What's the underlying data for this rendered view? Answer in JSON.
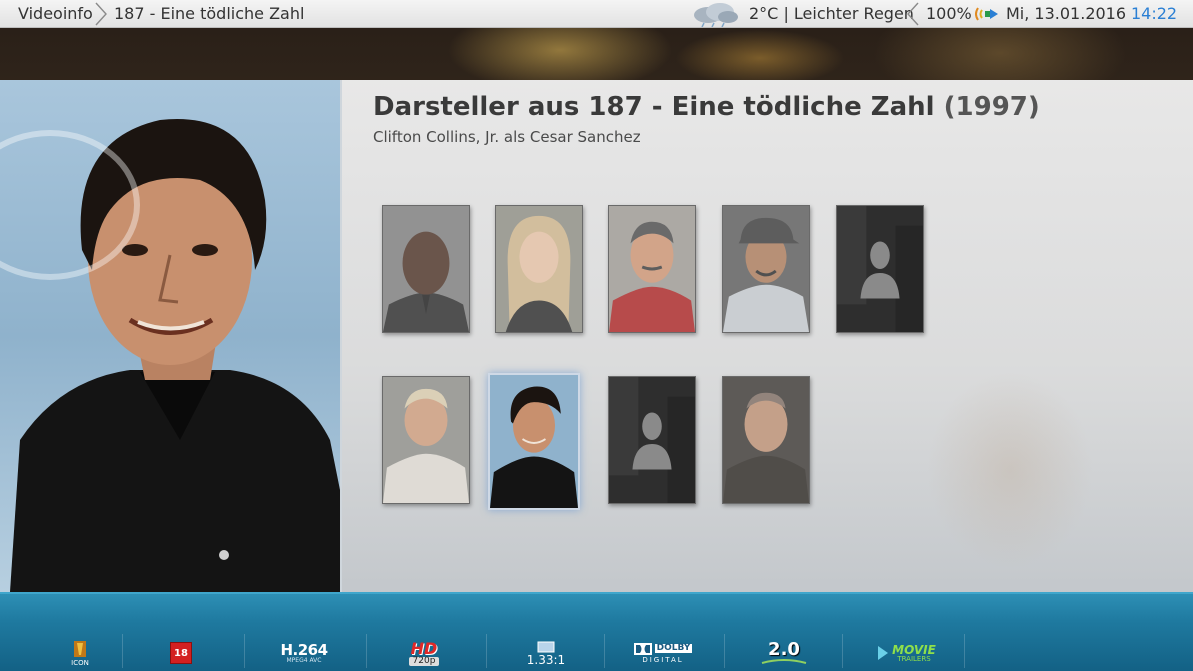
{
  "topbar": {
    "breadcrumb_root": "Videoinfo",
    "breadcrumb_current": "187 - Eine tödliche Zahl",
    "weather": "2°C | Leichter Regen",
    "volume": "100%",
    "date": "Mi, 13.01.2016",
    "time": "14:22"
  },
  "header": {
    "title_prefix": "Darsteller aus 187 - Eine tödliche Zahl",
    "title_year": "(1997)",
    "subtitle": "Clifton Collins, Jr. als Cesar Sanchez"
  },
  "cast": [
    {
      "id": "cast-1",
      "photo": "actor-photo"
    },
    {
      "id": "cast-2",
      "photo": "actor-photo"
    },
    {
      "id": "cast-3",
      "photo": "actor-photo"
    },
    {
      "id": "cast-4",
      "photo": "actor-photo"
    },
    {
      "id": "cast-5",
      "photo": "placeholder-silhouette"
    },
    {
      "id": "cast-6",
      "photo": "actor-photo"
    },
    {
      "id": "cast-7",
      "photo": "actor-photo",
      "selected": true
    },
    {
      "id": "cast-8",
      "photo": "placeholder-silhouette"
    },
    {
      "id": "cast-9",
      "photo": "actor-photo"
    }
  ],
  "media_flags": {
    "studio": "ICON",
    "fsk": "18",
    "codec_main": "H.264",
    "codec_sub": "MPEG4 AVC",
    "resolution_main": "HD",
    "resolution_sub": "720p",
    "aspect": "1.33:1",
    "audio_main": "DOLBY",
    "audio_sub": "DIGITAL",
    "channels": "2.0",
    "trailer_main": "MOVIE",
    "trailer_sub": "TRAILERS"
  },
  "colors": {
    "time_accent": "#2a7fd4",
    "bottom_bar": "#1f7aa0",
    "fsk_red": "#d42020"
  }
}
